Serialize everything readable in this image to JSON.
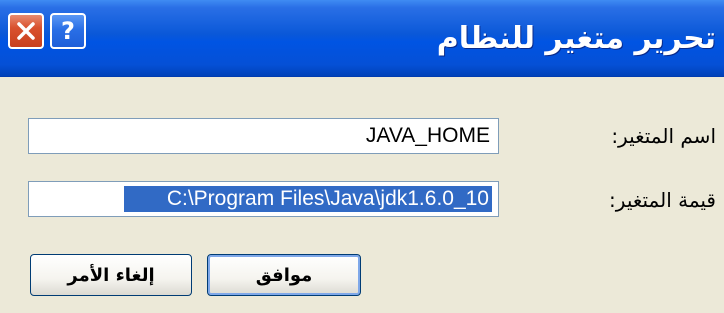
{
  "window": {
    "title": "تحرير متغير للنظام",
    "close_icon": "close-icon",
    "help_icon": "help-icon",
    "help_glyph": "?"
  },
  "form": {
    "name_label": "اسم المتغير:",
    "name_value": "JAVA_HOME",
    "value_label": "قيمة المتغير:",
    "value_value": "C:\\Program Files\\Java\\jdk1.6.0_10"
  },
  "buttons": {
    "ok_label": "موافق",
    "cancel_label": "إلغاء الأمر"
  }
}
